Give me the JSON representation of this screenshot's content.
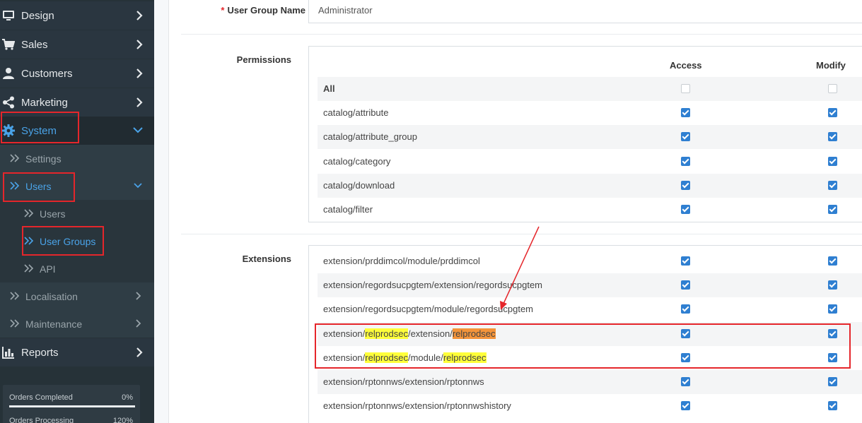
{
  "sidebar": {
    "menu": {
      "design": "Design",
      "sales": "Sales",
      "customers": "Customers",
      "marketing": "Marketing",
      "system": "System",
      "settings": "Settings",
      "users_group": "Users",
      "users": "Users",
      "user_groups": "User Groups",
      "api": "API",
      "localisation": "Localisation",
      "maintenance": "Maintenance",
      "reports": "Reports"
    },
    "stats": {
      "orders_completed_label": "Orders Completed",
      "orders_completed_value": "0%",
      "orders_processing_label": "Orders Processing",
      "orders_processing_value": "120%"
    }
  },
  "form": {
    "user_group_name_label": "User Group Name",
    "user_group_name_value": "Administrator",
    "permissions_label": "Permissions",
    "extensions_label": "Extensions",
    "access_header": "Access",
    "modify_header": "Modify",
    "permissions": [
      {
        "name": "All",
        "access": false,
        "modify": false
      },
      {
        "name": "catalog/attribute",
        "access": true,
        "modify": true
      },
      {
        "name": "catalog/attribute_group",
        "access": true,
        "modify": true
      },
      {
        "name": "catalog/category",
        "access": true,
        "modify": true
      },
      {
        "name": "catalog/download",
        "access": true,
        "modify": true
      },
      {
        "name": "catalog/filter",
        "access": true,
        "modify": true
      }
    ],
    "extensions": [
      {
        "name": "extension/prddimcol/module/prddimcol",
        "access": true,
        "modify": true
      },
      {
        "name": "extension/regordsucpgtem/extension/regordsucpgtem",
        "access": true,
        "modify": true
      },
      {
        "name": "extension/regordsucpgtem/module/regordsucpgtem",
        "access": true,
        "modify": true
      },
      {
        "name": "extension/relprodsec/extension/relprodsec",
        "parts": [
          "extension/",
          "relprodsec",
          "/extension/",
          "relprodsec"
        ],
        "access": true,
        "modify": true
      },
      {
        "name": "extension/relprodsec/module/relprodsec",
        "parts": [
          "extension/",
          "relprodsec",
          "/module/",
          "relprodsec"
        ],
        "access": true,
        "modify": true
      },
      {
        "name": "extension/rptonnws/extension/rptonnws",
        "access": true,
        "modify": true
      },
      {
        "name": "extension/rptonnws/extension/rptonnwshistory",
        "access": true,
        "modify": true
      }
    ]
  },
  "colors": {
    "sidebar_bg": "#263238",
    "active_link": "#4aa3e8",
    "checkbox_checked": "#2f7fd1",
    "annotation_red": "#e5262b",
    "highlight_yellow": "#ffff3a",
    "highlight_orange": "#f4943a"
  }
}
